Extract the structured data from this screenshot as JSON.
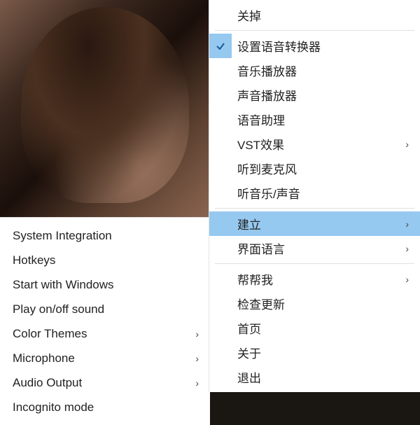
{
  "leftMenu": {
    "items": [
      {
        "label": "System Integration",
        "hasSubmenu": false
      },
      {
        "label": "Hotkeys",
        "hasSubmenu": false
      },
      {
        "label": "Start with Windows",
        "hasSubmenu": false
      },
      {
        "label": "Play on/off sound",
        "hasSubmenu": false
      },
      {
        "label": "Color Themes",
        "hasSubmenu": true
      },
      {
        "label": "Microphone",
        "hasSubmenu": true
      },
      {
        "label": "Audio Output",
        "hasSubmenu": true
      },
      {
        "label": "Incognito mode",
        "hasSubmenu": false
      }
    ]
  },
  "rightMenu": {
    "items": [
      {
        "label": "关掉",
        "checked": false,
        "hasSubmenu": false,
        "separatorAfter": true
      },
      {
        "label": "设置语音转换器",
        "checked": true,
        "hasSubmenu": false
      },
      {
        "label": "音乐播放器",
        "checked": false,
        "hasSubmenu": false
      },
      {
        "label": "声音播放器",
        "checked": false,
        "hasSubmenu": false
      },
      {
        "label": "语音助理",
        "checked": false,
        "hasSubmenu": false
      },
      {
        "label": "VST效果",
        "checked": false,
        "hasSubmenu": true
      },
      {
        "label": "听到麦克风",
        "checked": false,
        "hasSubmenu": false
      },
      {
        "label": "听音乐/声音",
        "checked": false,
        "hasSubmenu": false,
        "separatorAfter": true
      },
      {
        "label": "建立",
        "checked": false,
        "hasSubmenu": true,
        "highlighted": true
      },
      {
        "label": "界面语言",
        "checked": false,
        "hasSubmenu": true,
        "separatorAfter": true
      },
      {
        "label": "帮帮我",
        "checked": false,
        "hasSubmenu": true
      },
      {
        "label": "检查更新",
        "checked": false,
        "hasSubmenu": false
      },
      {
        "label": "首页",
        "checked": false,
        "hasSubmenu": false
      },
      {
        "label": "关于",
        "checked": false,
        "hasSubmenu": false
      },
      {
        "label": "退出",
        "checked": false,
        "hasSubmenu": false
      }
    ]
  },
  "glyphs": {
    "check": "✓",
    "chevron": "›"
  }
}
